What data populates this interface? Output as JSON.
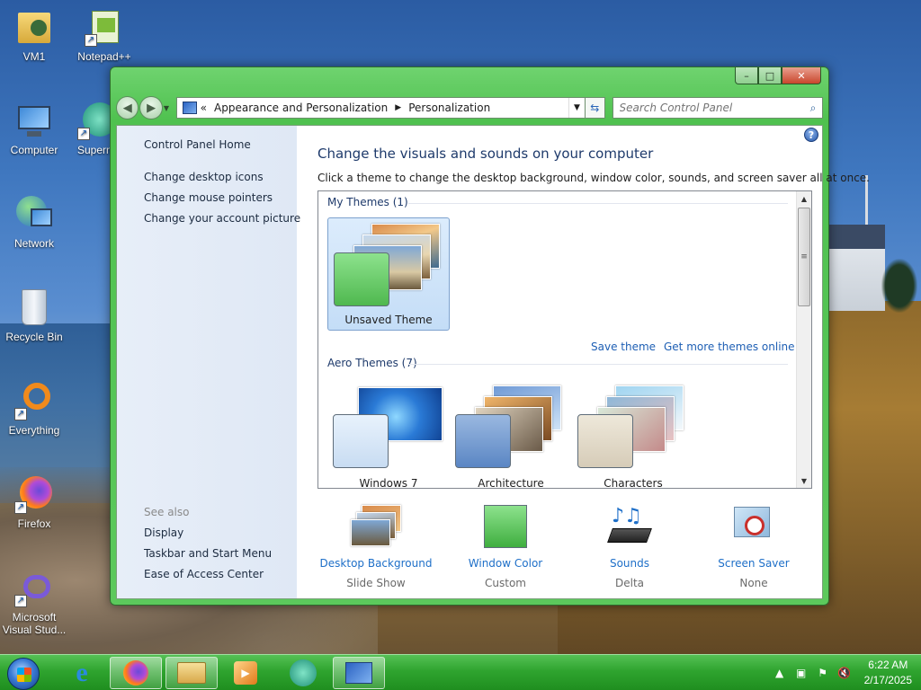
{
  "desktop": {
    "icons": [
      {
        "label": "VM1"
      },
      {
        "label": "Notepad++"
      },
      {
        "label": "Computer"
      },
      {
        "label": "Supern"
      },
      {
        "label": "Network"
      },
      {
        "label": "Recycle Bin"
      },
      {
        "label": "Everything"
      },
      {
        "label": "Firefox"
      },
      {
        "label": "Microsoft Visual Stud..."
      }
    ]
  },
  "window": {
    "caption": {
      "minimize": "–",
      "maximize": "□",
      "close": "✕"
    },
    "address": {
      "chevrons": "«",
      "segments": [
        "Appearance and Personalization",
        "Personalization"
      ],
      "separator": "▶"
    },
    "search": {
      "placeholder": "Search Control Panel"
    },
    "left_pane": {
      "home": "Control Panel Home",
      "links": [
        "Change desktop icons",
        "Change mouse pointers",
        "Change your account picture"
      ],
      "see_also_title": "See also",
      "see_also": [
        "Display",
        "Taskbar and Start Menu",
        "Ease of Access Center"
      ]
    },
    "main": {
      "title": "Change the visuals and sounds on your computer",
      "subtitle": "Click a theme to change the desktop background, window color, sounds, and screen saver all at once.",
      "my_themes": {
        "header": "My Themes (1)",
        "items": [
          {
            "label": "Unsaved Theme",
            "selected": true
          }
        ]
      },
      "actions": {
        "save": "Save theme",
        "more": "Get more themes online"
      },
      "aero_themes": {
        "header": "Aero Themes (7)",
        "items": [
          {
            "label": "Windows 7"
          },
          {
            "label": "Architecture"
          },
          {
            "label": "Characters"
          }
        ]
      },
      "bottom": [
        {
          "name": "Desktop Background",
          "value": "Slide Show"
        },
        {
          "name": "Window Color",
          "value": "Custom"
        },
        {
          "name": "Sounds",
          "value": "Delta"
        },
        {
          "name": "Screen Saver",
          "value": "None"
        }
      ]
    }
  },
  "taskbar": {
    "clock": {
      "time": "6:22 AM",
      "date": "2/17/2025"
    }
  },
  "colors": {
    "accent_green": "#4fc14f",
    "link_blue": "#1e6fc8",
    "title_navy": "#1e3a6b"
  }
}
